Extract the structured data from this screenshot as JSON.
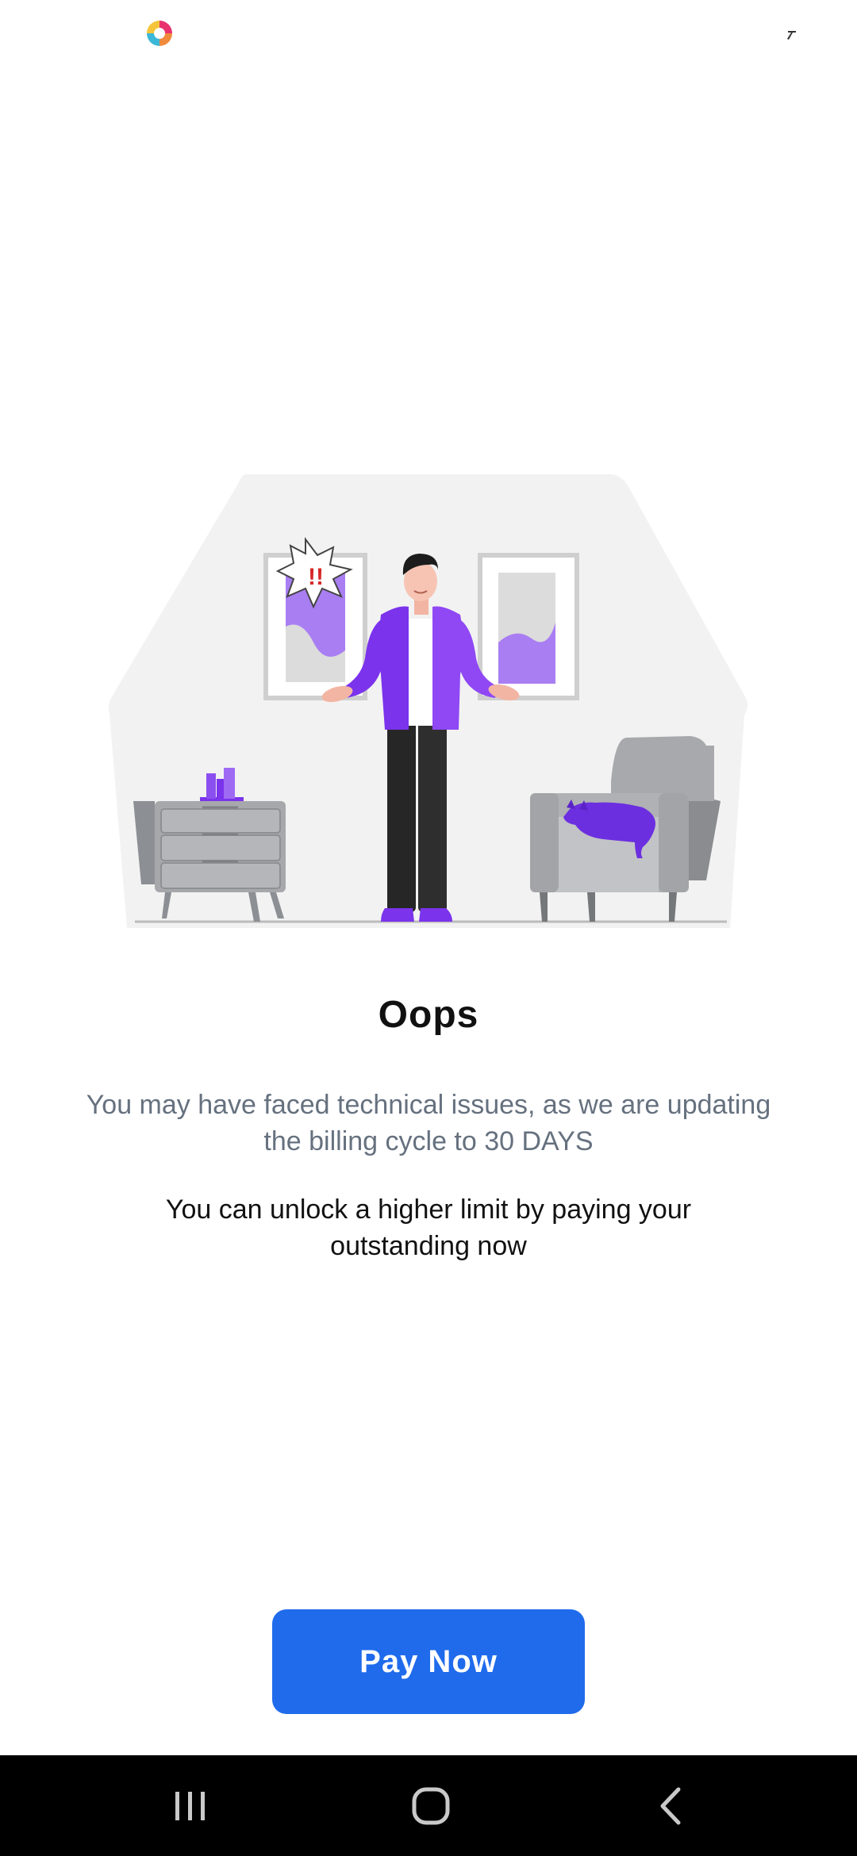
{
  "status_bar": {
    "logo_icon": "app-logo-icon",
    "network_icon": "signal-arrow-icon"
  },
  "illustration": {
    "alert_text": "!!"
  },
  "content": {
    "title": "Oops",
    "subtitle": "You may have faced technical issues, as we are updating the billing cycle to 30 DAYS",
    "body": "You can unlock a higher limit by paying your outstanding now"
  },
  "actions": {
    "pay_label": "Pay Now"
  },
  "nav_bar": {
    "recents_icon": "recents-icon",
    "home_icon": "home-icon",
    "back_icon": "back-icon"
  },
  "colors": {
    "primary": "#1f6bec",
    "accent_purple": "#7b33ec",
    "subtitle_gray": "#66717f",
    "nav_bg": "#000000"
  }
}
